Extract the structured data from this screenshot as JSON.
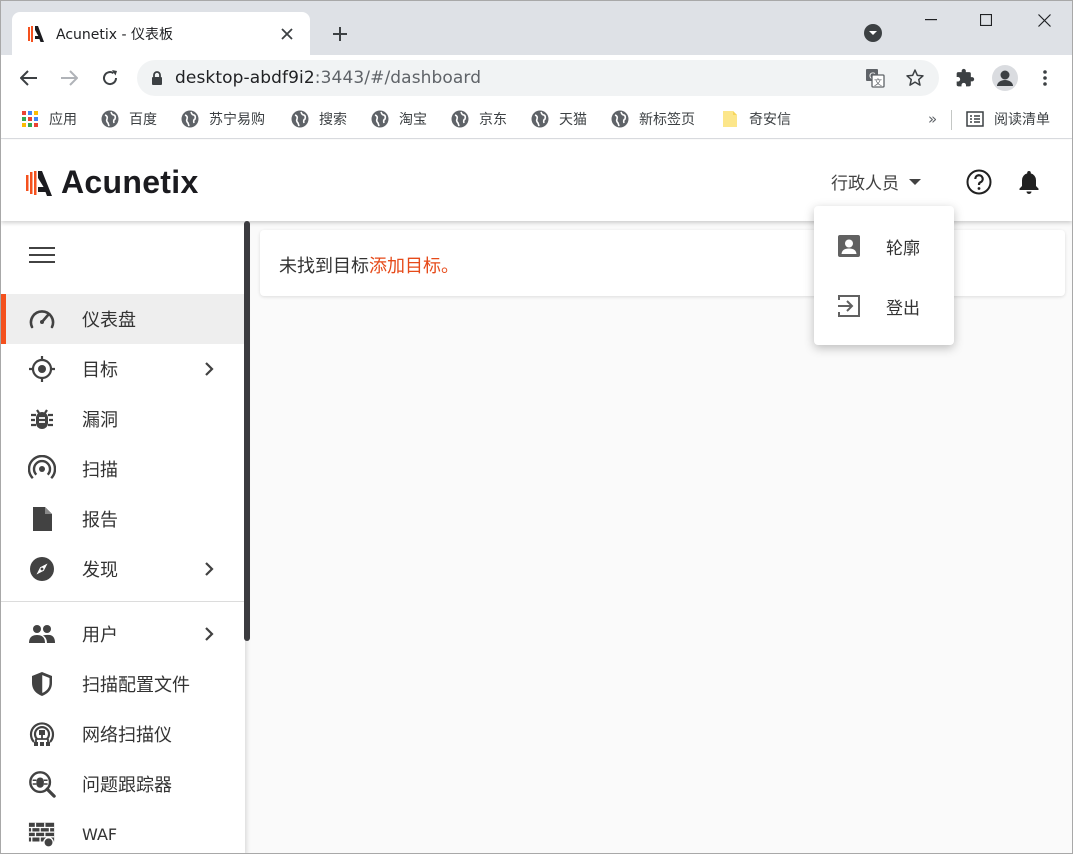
{
  "browser": {
    "tab": {
      "title": "Acunetix - 仪表板"
    },
    "address": {
      "host": "desktop-abdf9i2",
      "rest": ":3443/#/dashboard"
    },
    "bookmarks": [
      {
        "label": "应用",
        "icon": "apps-grid-icon"
      },
      {
        "label": "百度",
        "icon": "globe-icon"
      },
      {
        "label": "苏宁易购",
        "icon": "globe-icon"
      },
      {
        "label": "搜索",
        "icon": "globe-icon"
      },
      {
        "label": "淘宝",
        "icon": "globe-icon"
      },
      {
        "label": "京东",
        "icon": "globe-icon"
      },
      {
        "label": "天猫",
        "icon": "globe-icon"
      },
      {
        "label": "新标签页",
        "icon": "globe-icon"
      },
      {
        "label": "奇安信",
        "icon": "folder-icon"
      }
    ],
    "bookmarks_more": "»",
    "reading_list": "阅读清单"
  },
  "app": {
    "brand": "Acunetix",
    "user": "行政人员",
    "colors": {
      "accent": "#f4511e",
      "link": "#e64a19",
      "logo_dark": "#1b1b1f"
    }
  },
  "sidebar": {
    "items": [
      {
        "label": "仪表盘",
        "icon": "dashboard-gauge-icon",
        "active": true
      },
      {
        "label": "目标",
        "icon": "target-crosshair-icon",
        "has_submenu": true
      },
      {
        "label": "漏洞",
        "icon": "bug-icon"
      },
      {
        "label": "扫描",
        "icon": "scan-signal-icon"
      },
      {
        "label": "报告",
        "icon": "report-document-icon"
      },
      {
        "label": "发现",
        "icon": "compass-icon",
        "has_submenu": true
      },
      {
        "label": "用户",
        "icon": "users-icon",
        "has_submenu": true
      },
      {
        "label": "扫描配置文件",
        "icon": "shield-icon"
      },
      {
        "label": "网络扫描仪",
        "icon": "network-scanner-icon"
      },
      {
        "label": "问题跟踪器",
        "icon": "issue-tracker-icon"
      },
      {
        "label": "WAF",
        "icon": "firewall-icon"
      }
    ]
  },
  "main": {
    "empty_text": "未找到目标",
    "add_link": "添加目标。"
  },
  "dropdown": {
    "items": [
      {
        "label": "轮廓",
        "icon": "profile-icon"
      },
      {
        "label": "登出",
        "icon": "logout-icon"
      }
    ]
  }
}
